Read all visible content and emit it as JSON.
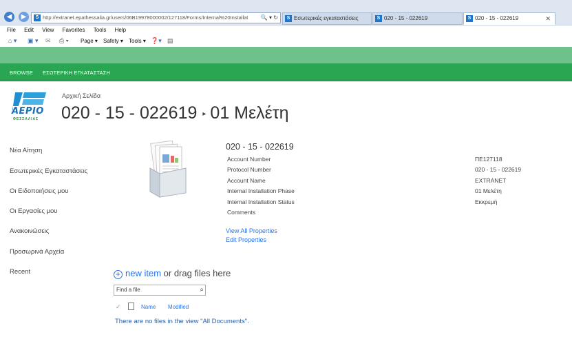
{
  "browser": {
    "address": "http://extranet.epathessalia.gr/users/06B19978000002/127118/Forms/Internal%20Installat",
    "address_domain": "epathessalia.gr",
    "tabs": [
      {
        "label": "Εσωτερικές εγκαταστάσεις"
      },
      {
        "label": "020 - 15 - 022619"
      },
      {
        "label": "020 - 15 - 022619"
      }
    ],
    "tab_close": "✕",
    "menu": [
      "File",
      "Edit",
      "View",
      "Favorites",
      "Tools",
      "Help"
    ],
    "commands": {
      "page": "Page ▾",
      "safety": "Safety ▾",
      "tools": "Tools ▾"
    }
  },
  "ribbon": {
    "browse": "BROWSE",
    "tab": "ΕΣΩΤΕΡΙΚΗ ΕΓΚΑΤΑΣΤΑΣΗ"
  },
  "logo": {
    "text": "ΑΕΡΙΟ",
    "subtext": "ΘΕΣΣΑΛΙΑΣ"
  },
  "header": {
    "home": "Αρχική Σελίδα",
    "title": "020 - 15 - 022619",
    "separator": "▸",
    "subtitle": "01 Μελέτη"
  },
  "leftnav": [
    "Νέα Αίτηση",
    "Εσωτερικές Εγκαταστάσεις",
    "Οι Ειδοποιήσεις μου",
    "Οι Εργασίες μου",
    "Ανακοινώσεις",
    "Προσωρινά Αρχεία",
    "Recent"
  ],
  "docset": {
    "title": "020 - 15 - 022619",
    "properties": [
      {
        "label": "Account Number",
        "value": "ΠΕ127118"
      },
      {
        "label": "Protocol Number",
        "value": "020 - 15 - 022619"
      },
      {
        "label": "Account Name",
        "value": "EXTRANET"
      },
      {
        "label": "Internal Installation Phase",
        "value": "01 Μελέτη"
      },
      {
        "label": "Internal Installation Status",
        "value": "Εκκρεμή"
      },
      {
        "label": "Comments",
        "value": ""
      }
    ],
    "view_all": "View All Properties",
    "edit": "Edit Properties"
  },
  "library": {
    "new_item": "new item",
    "or_drag": " or drag files here",
    "find_placeholder": "Find a file",
    "col_name": "Name",
    "col_modified": "Modified",
    "empty": "There are no files in the view \"All Documents\"."
  },
  "colors": {
    "ribbon": "#2aa552",
    "suite": "#6fc18b",
    "link": "#2672ec"
  }
}
